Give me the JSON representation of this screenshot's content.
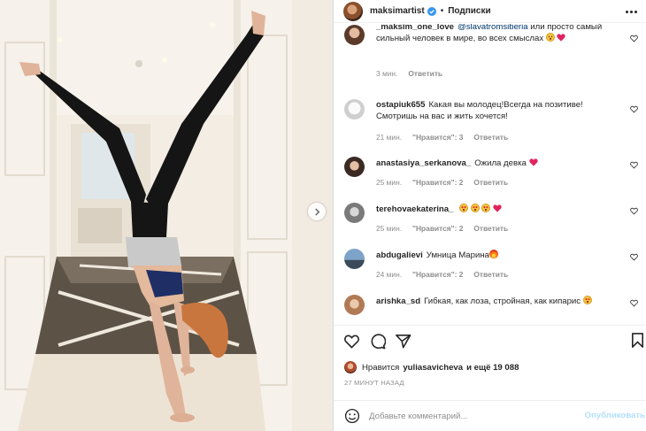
{
  "post": {
    "author": "maksimartist",
    "follow_label": "Подписки",
    "separator": "•"
  },
  "comments": [
    {
      "user": "_maksim_one_love",
      "text_prefix": "@slavatromsiberia",
      "text": "или просто самый сильный человек в мире, во всех смыслах",
      "emojis": [
        "smile",
        "heart"
      ],
      "time": "3 мин.",
      "likes": "",
      "reply": "Ответить"
    },
    {
      "user": "ostapiuk655",
      "text": "Какая вы молодец!Всегда на позитиве! Смотришь на вас и жить хочется!",
      "time": "21 мин.",
      "likes": "\"Нравится\": 3",
      "reply": "Ответить"
    },
    {
      "user": "anastasiya_serkanova_",
      "text": "Ожила девка",
      "time": "25 мин.",
      "likes": "\"Нравится\": 2",
      "reply": "Ответить"
    },
    {
      "user": "terehovaekaterina_",
      "text": "",
      "time": "25 мин.",
      "likes": "\"Нравится\": 2",
      "reply": "Ответить"
    },
    {
      "user": "abdugalievi",
      "text": "Умница Марина",
      "time": "24 мин.",
      "likes": "\"Нравится\": 2",
      "reply": "Ответить"
    },
    {
      "user": "arishka_sd",
      "text": "Гибкая, как лоза, стройная, как кипарис",
      "time": "",
      "likes": "",
      "reply": ""
    }
  ],
  "likes_line": {
    "prefix": "Нравится",
    "user": "yuliasavicheva",
    "suffix": "и ещё 19 088"
  },
  "timestamp": "27 МИНУТ НАЗАД",
  "composer": {
    "placeholder": "Добавьте комментарий...",
    "publish_label": "Опубликовать"
  },
  "colors": {
    "text": "#262626",
    "muted": "#8e8e8e",
    "verified": "#3897f0",
    "publish_disabled": "#b2dffc",
    "like_red": "#ed4956"
  },
  "icons": [
    "verified-icon",
    "more-options-icon",
    "comment-heart-icon",
    "like-icon",
    "comment-icon",
    "share-icon",
    "save-icon",
    "emoji-icon",
    "next-photo-icon"
  ]
}
